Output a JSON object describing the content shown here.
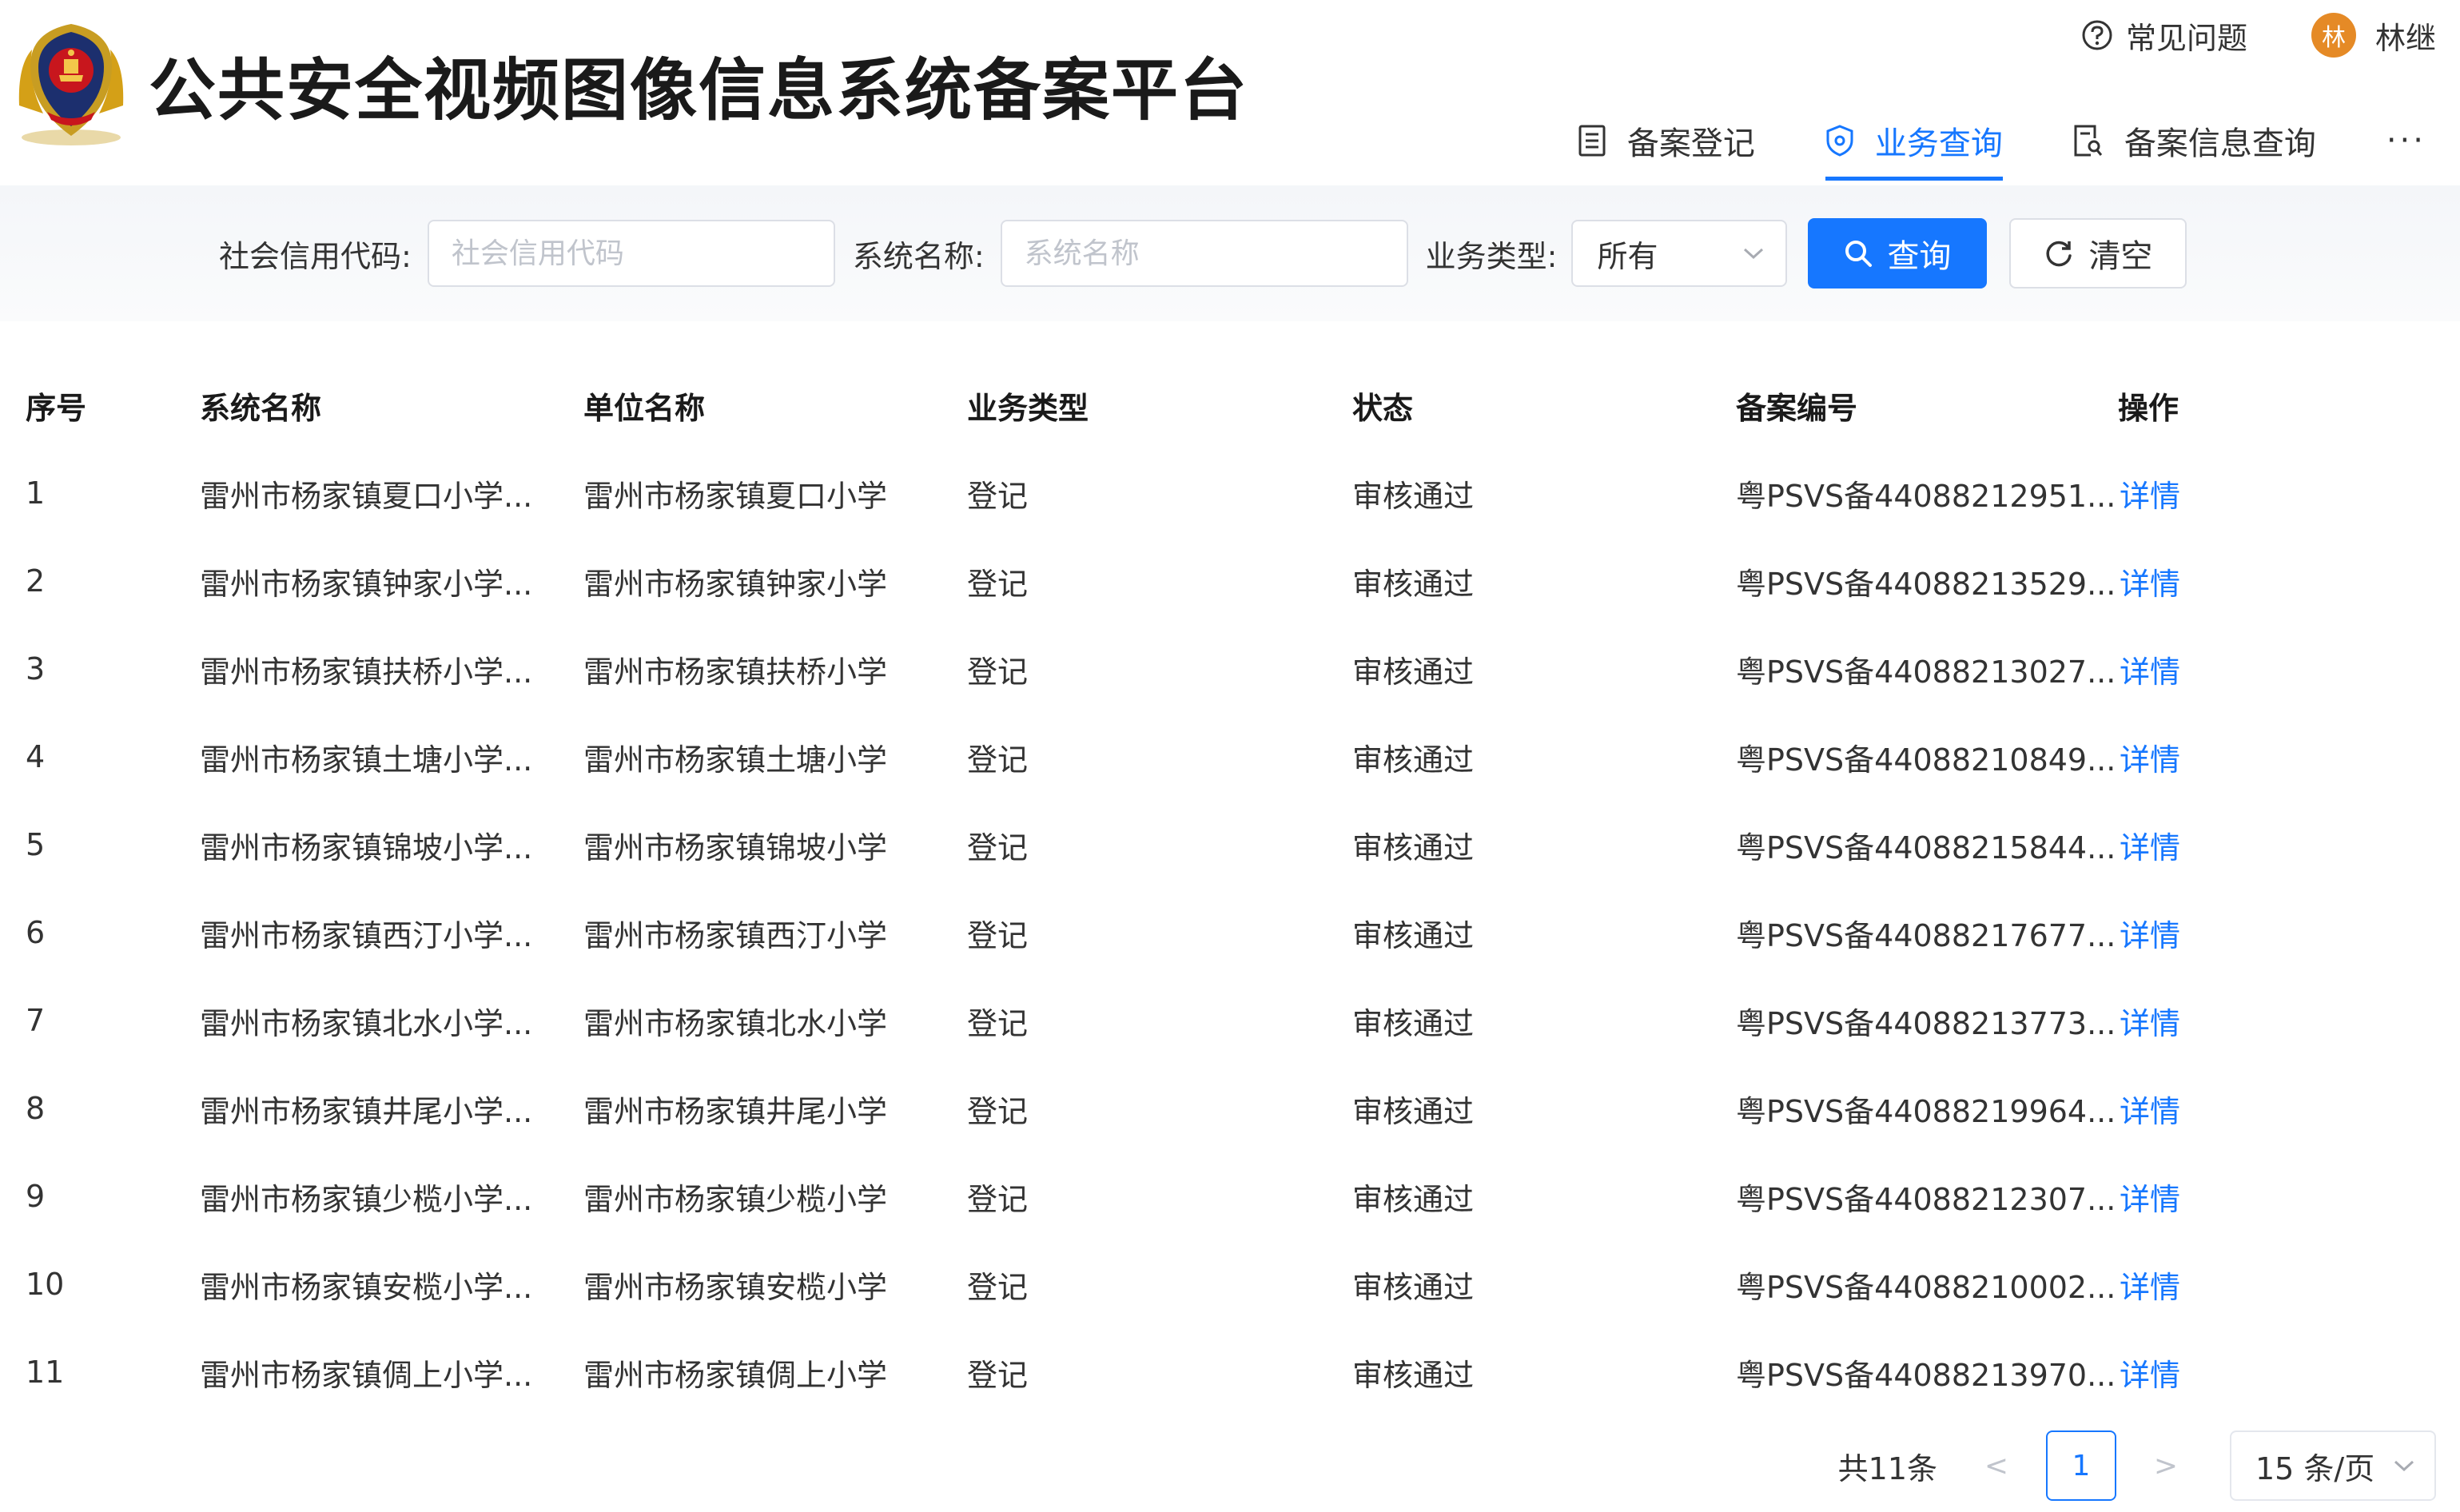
{
  "header": {
    "title": "公共安全视频图像信息系统备案平台",
    "faq_label": "常见问题",
    "user": {
      "avatar_text": "林",
      "name": "林继"
    },
    "nav": [
      {
        "label": "备案登记",
        "icon": "document-list-icon"
      },
      {
        "label": "业务查询",
        "icon": "shield-icon",
        "active": true
      },
      {
        "label": "备案信息查询",
        "icon": "document-search-icon"
      }
    ],
    "more_label": "···"
  },
  "filters": {
    "credit_code": {
      "label": "社会信用代码:",
      "placeholder": "社会信用代码",
      "value": ""
    },
    "system_name": {
      "label": "系统名称:",
      "placeholder": "系统名称",
      "value": ""
    },
    "business_type": {
      "label": "业务类型:",
      "value": "所有"
    },
    "search_button": "查询",
    "clear_button": "清空"
  },
  "table": {
    "headers": [
      "序号",
      "系统名称",
      "单位名称",
      "业务类型",
      "状态",
      "备案编号",
      "操作"
    ],
    "rows": [
      [
        "1",
        "雷州市杨家镇夏口小学...",
        "雷州市杨家镇夏口小学",
        "登记",
        "审核通过",
        "粤PSVS备44088212951...",
        "详情"
      ],
      [
        "2",
        "雷州市杨家镇钟家小学...",
        "雷州市杨家镇钟家小学",
        "登记",
        "审核通过",
        "粤PSVS备44088213529...",
        "详情"
      ],
      [
        "3",
        "雷州市杨家镇扶桥小学...",
        "雷州市杨家镇扶桥小学",
        "登记",
        "审核通过",
        "粤PSVS备44088213027...",
        "详情"
      ],
      [
        "4",
        "雷州市杨家镇土塘小学...",
        "雷州市杨家镇土塘小学",
        "登记",
        "审核通过",
        "粤PSVS备44088210849...",
        "详情"
      ],
      [
        "5",
        "雷州市杨家镇锦坡小学...",
        "雷州市杨家镇锦坡小学",
        "登记",
        "审核通过",
        "粤PSVS备44088215844...",
        "详情"
      ],
      [
        "6",
        "雷州市杨家镇西汀小学...",
        "雷州市杨家镇西汀小学",
        "登记",
        "审核通过",
        "粤PSVS备44088217677...",
        "详情"
      ],
      [
        "7",
        "雷州市杨家镇北水小学...",
        "雷州市杨家镇北水小学",
        "登记",
        "审核通过",
        "粤PSVS备44088213773...",
        "详情"
      ],
      [
        "8",
        "雷州市杨家镇井尾小学...",
        "雷州市杨家镇井尾小学",
        "登记",
        "审核通过",
        "粤PSVS备44088219964...",
        "详情"
      ],
      [
        "9",
        "雷州市杨家镇少榄小学...",
        "雷州市杨家镇少榄小学",
        "登记",
        "审核通过",
        "粤PSVS备44088212307...",
        "详情"
      ],
      [
        "10",
        "雷州市杨家镇安榄小学...",
        "雷州市杨家镇安榄小学",
        "登记",
        "审核通过",
        "粤PSVS备44088210002...",
        "详情"
      ],
      [
        "11",
        "雷州市杨家镇倜上小学...",
        "雷州市杨家镇倜上小学",
        "登记",
        "审核通过",
        "粤PSVS备44088213970...",
        "详情"
      ]
    ]
  },
  "pagination": {
    "total": "共11条",
    "prev": "<",
    "current": "1",
    "next": ">",
    "page_size": "15 条/页"
  },
  "colors": {
    "primary": "#1677ff",
    "avatar": "#e58a26",
    "emblem_red": "#c8161d",
    "emblem_gold": "#d4a017"
  }
}
